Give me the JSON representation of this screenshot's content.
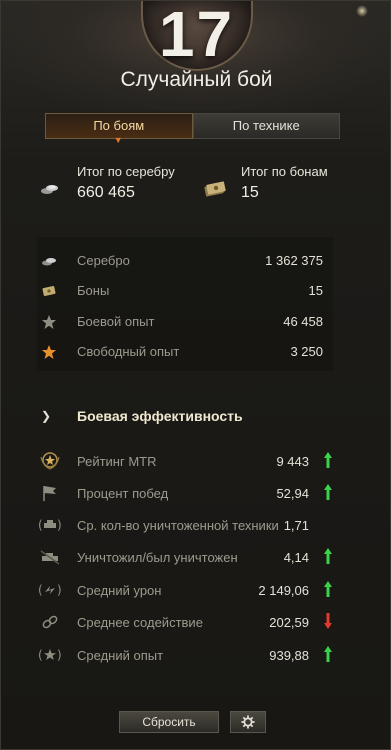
{
  "header": {
    "battle_number": "17",
    "battle_mode": "Случайный бой"
  },
  "tabs": [
    {
      "label": "По боям",
      "active": true
    },
    {
      "label": "По технике",
      "active": false
    }
  ],
  "totals": {
    "silver": {
      "label": "Итог по серебру",
      "value": "660 465",
      "icon": "silver-coins-icon"
    },
    "bonds": {
      "label": "Итог по бонам",
      "value": "15",
      "icon": "bonds-icon"
    }
  },
  "income": [
    {
      "label": "Серебро",
      "value": "1 362 375",
      "icon": "silver-icon"
    },
    {
      "label": "Боны",
      "value": "15",
      "icon": "bonds-icon"
    },
    {
      "label": "Боевой опыт",
      "value": "46 458",
      "icon": "star-icon"
    },
    {
      "label": "Свободный опыт",
      "value": "3 250",
      "icon": "free-xp-star-icon"
    }
  ],
  "efficiency": {
    "title": "Боевая эффективность",
    "rows": [
      {
        "label": "Рейтинг MTR",
        "value": "9 443",
        "trend": "up",
        "icon": "rating-badge-icon"
      },
      {
        "label": "Процент побед",
        "value": "52,94",
        "trend": "up",
        "icon": "flag-icon"
      },
      {
        "label": "Ср. кол-во уничтоженной техники",
        "value": "1,71",
        "trend": "none",
        "icon": "destroyed-tank-icon"
      },
      {
        "label": "Уничтожил/был уничтожен",
        "value": "4,14",
        "trend": "up",
        "icon": "kill-death-icon"
      },
      {
        "label": "Средний урон",
        "value": "2 149,06",
        "trend": "up",
        "icon": "damage-icon"
      },
      {
        "label": "Среднее содействие",
        "value": "202,59",
        "trend": "down",
        "icon": "assist-icon"
      },
      {
        "label": "Средний опыт",
        "value": "939,88",
        "trend": "up",
        "icon": "xp-star-icon"
      }
    ]
  },
  "footer": {
    "reset_label": "Сбросить",
    "settings_icon": "gear-icon"
  },
  "colors": {
    "accent_orange": "#e07a2a",
    "trend_up": "#3bd24a",
    "trend_down": "#e03a2a"
  }
}
